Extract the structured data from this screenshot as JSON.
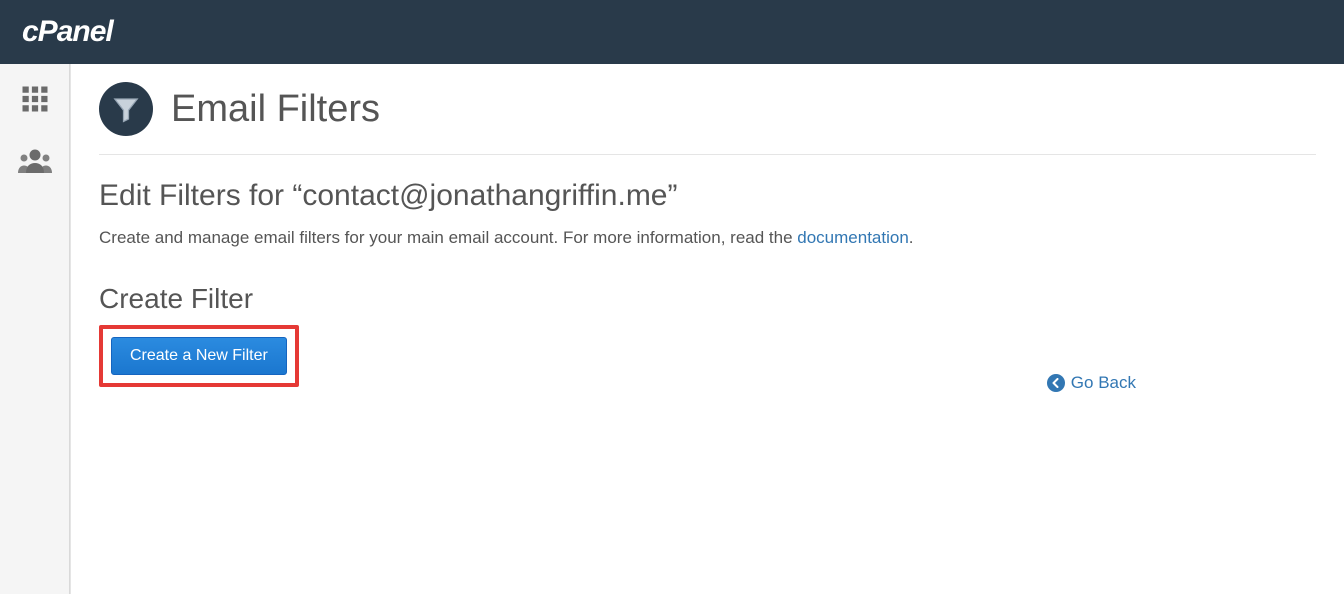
{
  "header": {
    "logo_text": "cPanel"
  },
  "page": {
    "title": "Email Filters",
    "subtitle_prefix": "Edit Filters for “",
    "subtitle_email": "contact@jonathangriffin.me",
    "subtitle_suffix": "”",
    "description_text": "Create and manage email filters for your main email account. For more information, read the ",
    "description_link": "documentation",
    "description_period": "."
  },
  "section": {
    "create_title": "Create Filter",
    "create_button": "Create a New Filter"
  },
  "nav": {
    "go_back": "Go Back"
  }
}
